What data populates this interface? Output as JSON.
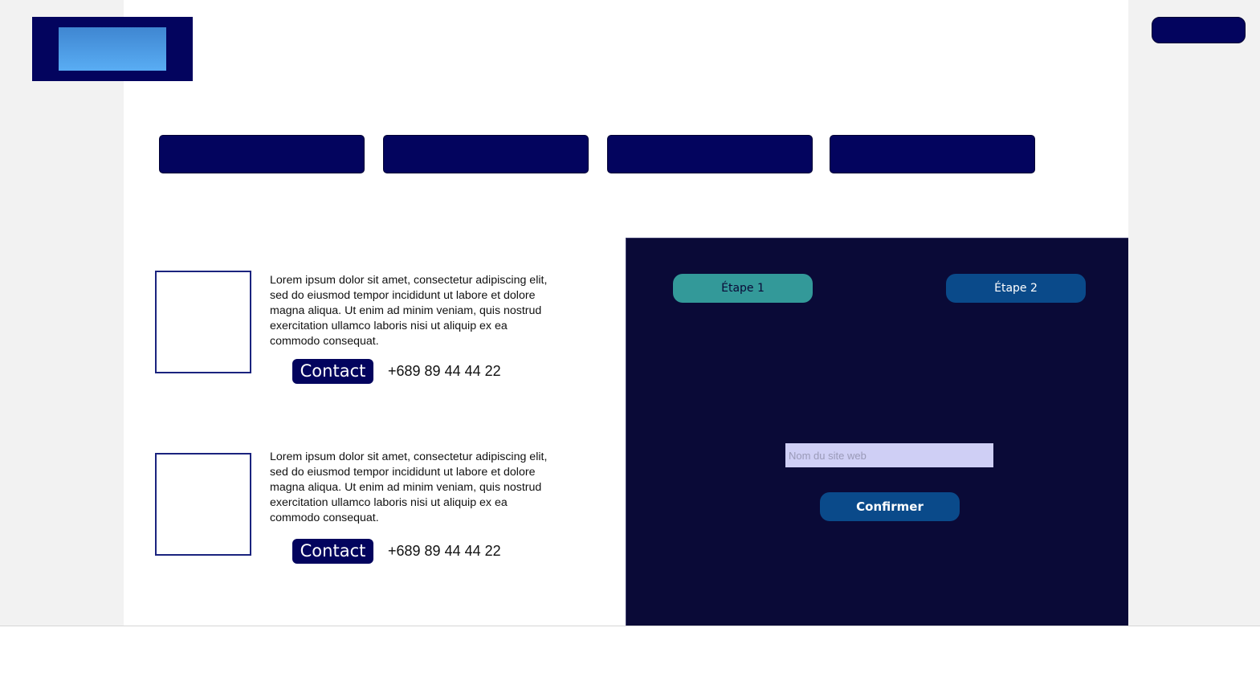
{
  "header": {
    "logo_icon": "logo-gradient-block",
    "top_right_button_label": ""
  },
  "nav": {
    "buttons": [
      {
        "label": ""
      },
      {
        "label": ""
      },
      {
        "label": ""
      },
      {
        "label": ""
      }
    ]
  },
  "cards": [
    {
      "text": "Lorem ipsum dolor sit amet, consectetur adipiscing elit, sed do eiusmod tempor incididunt ut labore et dolore magna aliqua. Ut enim ad minim veniam, quis nostrud exercitation ullamco laboris nisi ut aliquip ex ea commodo consequat.",
      "contact_label": "Contact",
      "phone": "+689 89 44 44 22"
    },
    {
      "text": "Lorem ipsum dolor sit amet, consectetur adipiscing elit, sed do eiusmod tempor incididunt ut labore et dolore magna aliqua. Ut enim ad minim veniam, quis nostrud exercitation ullamco laboris nisi ut aliquip ex ea commodo consequat.",
      "contact_label": "Contact",
      "phone": "+689 89 44 44 22"
    }
  ],
  "panel": {
    "step1_label": "Étape 1",
    "step2_label": "Étape 2",
    "site_input": {
      "value": "",
      "placeholder": "Nom du site web"
    },
    "confirm_label": "Confirmer"
  },
  "colors": {
    "navy": "#03045e",
    "panel_bg": "#0a0a37",
    "teal": "#339999",
    "blue": "#0a4a8a",
    "input_bg": "#cfcff5"
  }
}
